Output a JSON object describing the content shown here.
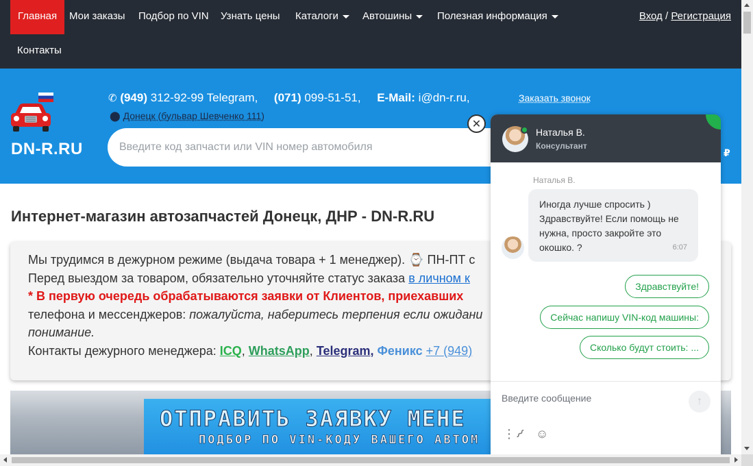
{
  "nav": {
    "items": [
      {
        "label": "Главная",
        "active": true
      },
      {
        "label": "Мои заказы"
      },
      {
        "label": "Подбор по VIN"
      },
      {
        "label": "Узнать цены"
      },
      {
        "label": "Каталоги",
        "dropdown": true
      },
      {
        "label": "Автошины",
        "dropdown": true
      },
      {
        "label": "Полезная информация",
        "dropdown": true
      },
      {
        "label": "Контакты"
      }
    ],
    "login": "Вход",
    "separator": "/",
    "register": "Регистрация"
  },
  "header": {
    "logo_text": "DN-R.RU",
    "phone1_code": "(949)",
    "phone1_rest": "312-92-99 Telegram,",
    "phone2_code": "(071)",
    "phone2_rest": "099-51-51,",
    "email_label": "E-Mail:",
    "email": "i@dn-r.ru,",
    "callback": "Заказать звонок",
    "address": "Донецк (бульвар Шевченко 111)",
    "search_placeholder": "Введите код запчасти или VIN номер автомобиля",
    "currency": "₽"
  },
  "content": {
    "title": "Интернет-магазин автозапчастей Донецк, ДНР - DN-R.RU",
    "line1": "Мы трудимся в дежурном режиме (выдача товара + 1 менеджер). ⌚ ПН-ПТ с",
    "line2_text": "Перед выездом за товаром, обязательно уточняйте статус заказа ",
    "line2_link": "в личном к",
    "line3": "* В первую очередь обрабатываются заявки от Клиентов, приехавших",
    "line4_text": "телефона и мессенджеров: ",
    "line4_italic": "пожалуйста, наберитесь терпения если ожидани",
    "line5_italic": "понимание.",
    "contacts_label": "Контакты дежурного менеджера: ",
    "c_icq": "ICQ",
    "c_wa": "WhatsApp",
    "c_tg": "Telegram,",
    "c_fx": "Феникс",
    "c_phone": "+7 (949)",
    "banner_line1": "ОТПРАВИТЬ ЗАЯВКУ МЕНЕ",
    "banner_line2": "ПОДБОР ПО VIN-КОДУ ВАШЕГО АВТОМ"
  },
  "chat": {
    "agent_name": "Наталья В.",
    "agent_role": "Консультант",
    "message_author": "Наталья В.",
    "message_text": "Иногда лучше спросить ) Здравствуйте! Если помощь не нужна, просто закройте это окошко. ?",
    "message_time": "6:07",
    "quick_replies": [
      "Здравствуйте!",
      "Сейчас напишу VIN-код машины:",
      "Сколько будут стоить: ..."
    ],
    "input_placeholder": "Введите сообщение",
    "status_color": "#22b14c"
  },
  "colors": {
    "nav_bg": "#262c35",
    "active_red": "#e02020",
    "header_blue": "#1a8fe0",
    "chat_head": "#373d45",
    "accent_green": "#22a04a"
  }
}
